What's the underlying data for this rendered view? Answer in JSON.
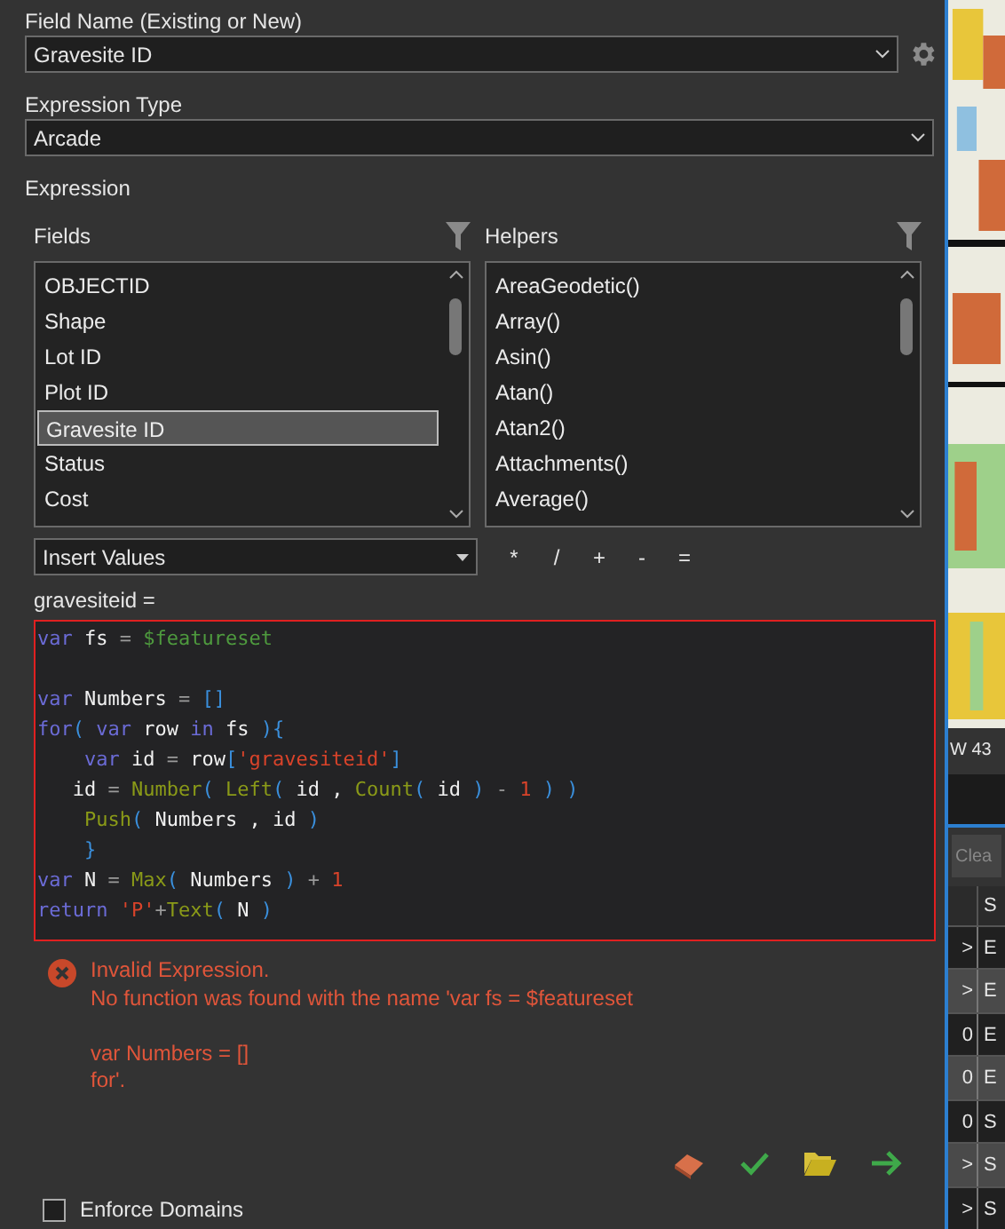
{
  "field_name": {
    "label": "Field Name (Existing or New)",
    "value": "Gravesite ID"
  },
  "expression_type": {
    "label": "Expression Type",
    "value": "Arcade"
  },
  "expression": {
    "label": "Expression",
    "fields": {
      "title": "Fields",
      "items": [
        {
          "label": "OBJECTID",
          "selected": false
        },
        {
          "label": "Shape",
          "selected": false
        },
        {
          "label": "Lot ID",
          "selected": false
        },
        {
          "label": "Plot ID",
          "selected": false
        },
        {
          "label": "Gravesite ID",
          "selected": true
        },
        {
          "label": "Status",
          "selected": false
        },
        {
          "label": "Cost",
          "selected": false
        }
      ]
    },
    "helpers": {
      "title": "Helpers",
      "items": [
        {
          "label": "AreaGeodetic()",
          "selected": false
        },
        {
          "label": "Array()",
          "selected": false
        },
        {
          "label": "Asin()",
          "selected": false
        },
        {
          "label": "Atan()",
          "selected": false
        },
        {
          "label": "Atan2()",
          "selected": false
        },
        {
          "label": "Attachments()",
          "selected": false
        },
        {
          "label": "Average()",
          "selected": false
        }
      ]
    },
    "insert_values": "Insert Values",
    "operators": [
      "*",
      "/",
      "+",
      "-",
      "="
    ],
    "target": "gravesiteid =",
    "invalid": true,
    "code": [
      {
        "tokens": [
          {
            "kind": "keyword",
            "text": "var"
          },
          {
            "kind": "plain",
            "text": " fs "
          },
          {
            "kind": "op",
            "text": "= "
          },
          {
            "kind": "global",
            "text": "$featureset"
          }
        ]
      },
      {
        "kind": "blank"
      },
      {
        "tokens": [
          {
            "kind": "keyword",
            "text": "var"
          },
          {
            "kind": "plain",
            "text": " Numbers "
          },
          {
            "kind": "op",
            "text": "= "
          },
          {
            "kind": "bracket",
            "text": "[]"
          }
        ]
      },
      {
        "tokens": [
          {
            "kind": "keyword",
            "text": "for"
          },
          {
            "kind": "bracket",
            "text": "( "
          },
          {
            "kind": "keyword",
            "text": "var"
          },
          {
            "kind": "plain",
            "text": " row "
          },
          {
            "kind": "keyword",
            "text": "in"
          },
          {
            "kind": "plain",
            "text": " fs "
          },
          {
            "kind": "bracket",
            "text": "){"
          }
        ]
      },
      {
        "tokens": [
          {
            "kind": "keyword",
            "text": "    var"
          },
          {
            "kind": "plain",
            "text": " id "
          },
          {
            "kind": "op",
            "text": "= "
          },
          {
            "kind": "plain",
            "text": "row"
          },
          {
            "kind": "bracket",
            "text": "["
          },
          {
            "kind": "string",
            "text": "'gravesiteid'"
          },
          {
            "kind": "bracket",
            "text": "]"
          }
        ]
      },
      {
        "tokens": [
          {
            "kind": "plain",
            "text": "   id "
          },
          {
            "kind": "op",
            "text": "= "
          },
          {
            "kind": "function",
            "text": "Number"
          },
          {
            "kind": "bracket",
            "text": "( "
          },
          {
            "kind": "function",
            "text": "Left"
          },
          {
            "kind": "bracket",
            "text": "( "
          },
          {
            "kind": "plain",
            "text": "id , "
          },
          {
            "kind": "function",
            "text": "Count"
          },
          {
            "kind": "bracket",
            "text": "( "
          },
          {
            "kind": "plain",
            "text": "id "
          },
          {
            "kind": "bracket",
            "text": ") "
          },
          {
            "kind": "op",
            "text": "- "
          },
          {
            "kind": "number",
            "text": "1"
          },
          {
            "kind": "bracket",
            "text": " ) )"
          }
        ]
      },
      {
        "tokens": [
          {
            "kind": "function",
            "text": "    Push"
          },
          {
            "kind": "bracket",
            "text": "( "
          },
          {
            "kind": "plain",
            "text": "Numbers , id "
          },
          {
            "kind": "bracket",
            "text": ")"
          }
        ]
      },
      {
        "tokens": [
          {
            "kind": "bracket",
            "text": "    }"
          }
        ]
      },
      {
        "tokens": [
          {
            "kind": "keyword",
            "text": "var"
          },
          {
            "kind": "plain",
            "text": " N "
          },
          {
            "kind": "op",
            "text": "= "
          },
          {
            "kind": "function",
            "text": "Max"
          },
          {
            "kind": "bracket",
            "text": "( "
          },
          {
            "kind": "plain",
            "text": "Numbers "
          },
          {
            "kind": "bracket",
            "text": ") "
          },
          {
            "kind": "op",
            "text": "+ "
          },
          {
            "kind": "number",
            "text": "1"
          }
        ]
      },
      {
        "tokens": [
          {
            "kind": "keyword",
            "text": "return"
          },
          {
            "kind": "string",
            "text": " 'P'"
          },
          {
            "kind": "op",
            "text": "+"
          },
          {
            "kind": "function",
            "text": "Text"
          },
          {
            "kind": "bracket",
            "text": "( "
          },
          {
            "kind": "plain",
            "text": "N "
          },
          {
            "kind": "bracket",
            "text": ")"
          }
        ]
      }
    ],
    "error": {
      "title": "Invalid Expression.",
      "message": "No function was found with the name 'var fs = $featureset\n\nvar Numbers = []\nfor'."
    }
  },
  "enforce_domains": {
    "label": "Enforce Domains",
    "checked": false
  },
  "side": {
    "status": "W 43",
    "button": "Clea",
    "table": {
      "header": "S",
      "rows": [
        [
          ">",
          "E"
        ],
        [
          ">",
          "E"
        ],
        [
          "0",
          "E"
        ],
        [
          "0",
          "E"
        ],
        [
          "0",
          "S"
        ],
        [
          ">",
          "S"
        ],
        [
          ">",
          "S"
        ]
      ]
    }
  }
}
